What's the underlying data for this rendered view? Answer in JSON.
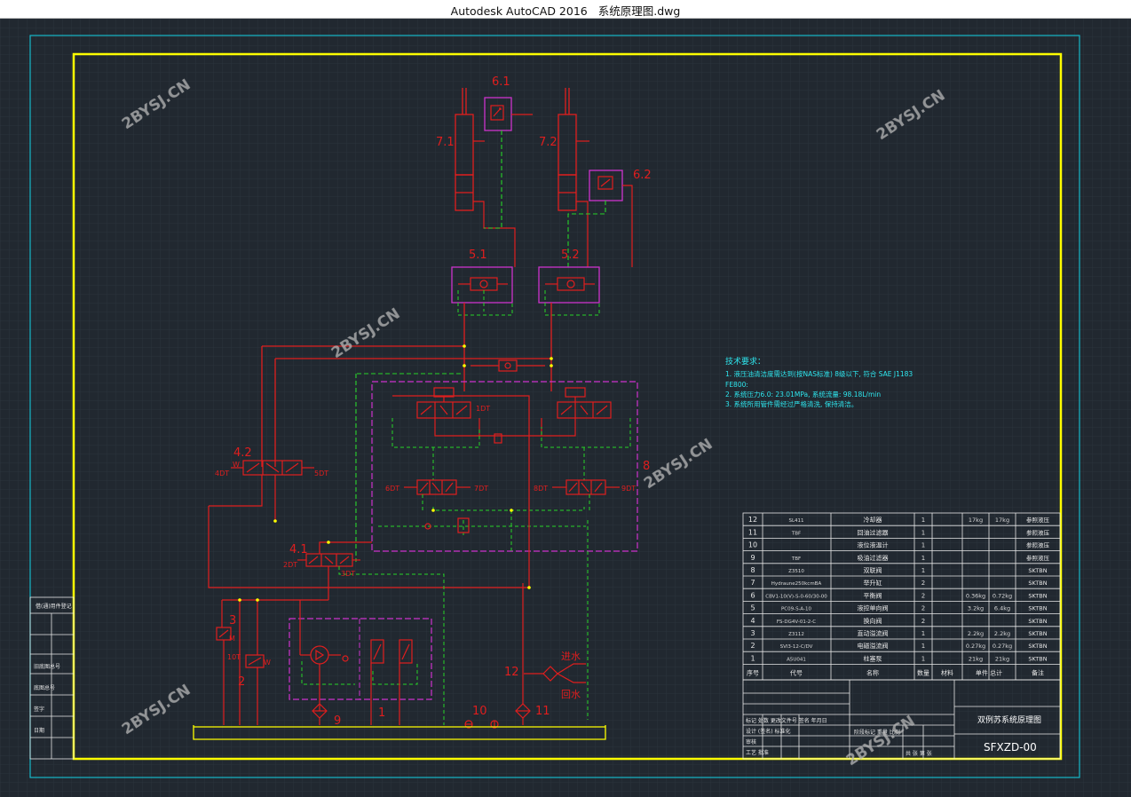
{
  "app": {
    "name": "Autodesk AutoCAD 2016",
    "file": "系统原理图.dwg"
  },
  "colors": {
    "background": "#212830",
    "grid": "#2a333d",
    "outer_frame": "#17b8c8",
    "inner_frame": "#ffff00",
    "hydraulic_line": "#e01e1e",
    "pilot_line": "#28d428",
    "group_box": "#cc33cc",
    "text_cyan": "#2ee6ee",
    "text_white": "#e8e8e8",
    "watermark": "#b8b8b8"
  },
  "watermark": "2BYSJ.CN",
  "labels": {
    "c61": "6.1",
    "c62": "6.2",
    "c71": "7.1",
    "c72": "7.2",
    "v51": "5.1",
    "v52": "5.2",
    "v42": "4.2",
    "v41": "4.1",
    "s4dt": "4DT",
    "s5dt": "5DT",
    "s2dt": "2DT",
    "s3dt": "3DT",
    "s6dt": "6DT",
    "s7dt": "7DT",
    "s8dt": "8DT",
    "s9dt": "9DT",
    "s1dt": "1DT",
    "s10t": "10T",
    "blockB": "8",
    "n3": "3",
    "n2": "2",
    "n1": "1",
    "n9": "9",
    "n10": "10",
    "n11": "11",
    "n12": "12",
    "m": "M",
    "w": "W",
    "water_in": "进水",
    "water_out": "回水"
  },
  "notes": {
    "heading": "技术要求：",
    "line1": "1. 液压油清洁度需达到(按NAS标准) 8级以下, 符合 SAE J1183",
    "line2": "FE800:",
    "line3": "2. 系统压力6.0: 23.01MPa, 系统流量: 98.18L/min",
    "line4": "3. 系统所用管件需经过严格清洗, 保持清洁。"
  },
  "bom_rows": [
    {
      "no": "12",
      "code": "SL411",
      "name": "冷却器",
      "qty": "1",
      "w1": "17kg",
      "w2": "17kg",
      "note": "参照液压"
    },
    {
      "no": "11",
      "code": "TBF",
      "name": "回油过滤器",
      "qty": "1",
      "w1": "",
      "w2": "",
      "note": "参照液压"
    },
    {
      "no": "10",
      "code": "",
      "name": "液位液温计",
      "qty": "1",
      "w1": "",
      "w2": "",
      "note": "参照液压"
    },
    {
      "no": "9",
      "code": "TBF",
      "name": "吸油过滤器",
      "qty": "1",
      "w1": "",
      "w2": "",
      "note": "参照液压"
    },
    {
      "no": "8",
      "code": "Z3510",
      "name": "双联阀",
      "qty": "1",
      "w1": "",
      "w2": "",
      "note": "SKTBN"
    },
    {
      "no": "7",
      "code": "Hydraune250kcmBA",
      "name": "举升缸",
      "qty": "2",
      "w1": "",
      "w2": "",
      "note": "SKTBN"
    },
    {
      "no": "6",
      "code": "CBV1-10(V)-S-0-60/30-00",
      "name": "平衡阀",
      "qty": "2",
      "w1": "0.36kg",
      "w2": "0.72kg",
      "note": "SKTBN"
    },
    {
      "no": "5",
      "code": "PC09-S-A-10",
      "name": "液控单向阀",
      "qty": "2",
      "w1": "3.2kg",
      "w2": "6.4kg",
      "note": "SKTBN"
    },
    {
      "no": "4",
      "code": "FS-DG4V-01-2-C",
      "name": "换向阀",
      "qty": "2",
      "w1": "",
      "w2": "",
      "note": "SKTBN"
    },
    {
      "no": "3",
      "code": "Z3112",
      "name": "直动溢流阀",
      "qty": "1",
      "w1": "2.2kg",
      "w2": "2.2kg",
      "note": "SKTBN"
    },
    {
      "no": "2",
      "code": "SVl3-12-C/DV",
      "name": "电磁溢流阀",
      "qty": "1",
      "w1": "0.27kg",
      "w2": "0.27kg",
      "note": "SKTBN"
    },
    {
      "no": "1",
      "code": "A5U041",
      "name": "柱塞泵",
      "qty": "1",
      "w1": "21kg",
      "w2": "21kg",
      "note": "SKTBN"
    }
  ],
  "bom_header": {
    "no": "序号",
    "code": "代号",
    "name": "名称",
    "qty": "数量",
    "mat": "材料",
    "weight": "单件 总计",
    "wt": "重量",
    "note": "备注"
  },
  "title_block": {
    "drawing_title": "双例苏系统原理图",
    "drawing_no": "SFXZD-00",
    "row1": "标记 处数 更改文件号 签名 年月日",
    "row2": "设计 (签名) 标准化",
    "row3": "审核",
    "row4": "工艺 批准",
    "stage": "阶段标记 重量 比例",
    "sheet": "共 张 第 张"
  },
  "side_table": [
    "借(通)用件登记",
    "旧底图总号",
    "底图总号",
    "签字",
    "日期"
  ]
}
